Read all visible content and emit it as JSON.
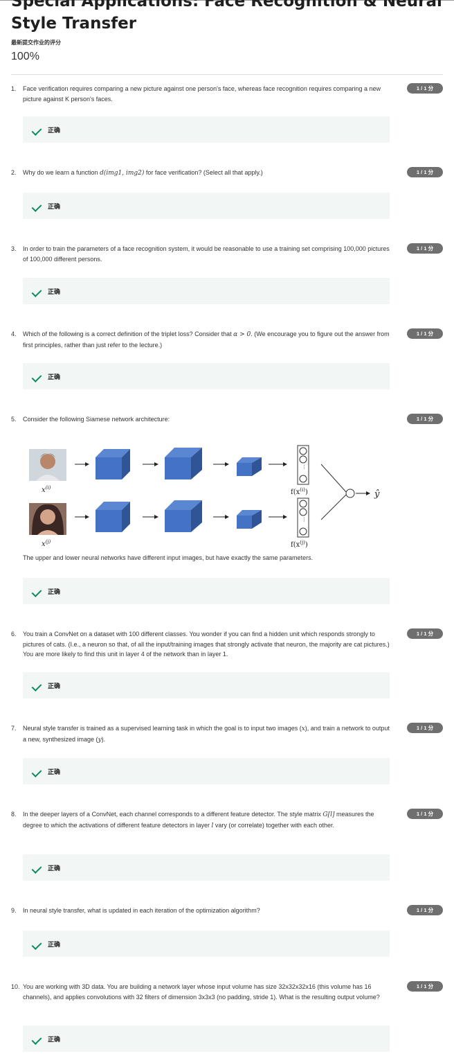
{
  "page": {
    "title": "Special Applications: Face Recognition & Neural Style Transfer",
    "grade_label": "最新提交作业的评分",
    "grade_value": "100%"
  },
  "correct_label": "正确",
  "questions": [
    {
      "num": "1.",
      "text": "Face verification requires comparing a new picture against one person's face, whereas face recognition requires comparing a new picture against K person's faces.",
      "score": "1 / 1 分"
    },
    {
      "num": "2.",
      "text_before": "Why do we learn a function ",
      "formula": "d(img1, img2)",
      "text_after": " for face verification? (Select all that apply.)",
      "score": "1 / 1 分"
    },
    {
      "num": "3.",
      "text": "In order to train the parameters of a face recognition system, it would be reasonable to use a training set comprising 100,000 pictures of 100,000 different persons.",
      "score": "1 / 1 分"
    },
    {
      "num": "4.",
      "text_before": "Which of the following is a correct definition of the triplet loss? Consider that ",
      "formula": "α > 0",
      "text_after": ". (We encourage you to figure out the answer from first principles, rather than just refer to the lecture.)",
      "score": "1 / 1 分"
    },
    {
      "num": "5.",
      "text": "Consider the following Siamese network architecture:",
      "score": "1 / 1 分",
      "caption": "The upper and lower neural networks have different input images, but have exactly the same parameters.",
      "diagram": {
        "upper_input": "x(i)",
        "lower_input": "x(j)",
        "upper_output": "f(x(i))",
        "lower_output": "f(x(j))",
        "output": "ŷ"
      }
    },
    {
      "num": "6.",
      "text": "You train a ConvNet on a dataset with 100 different classes. You wonder if you can find a hidden unit which responds strongly to pictures of cats. (I.e., a neuron so that, of all the input/training images that strongly activate that neuron, the majority are cat pictures.) You are more likely to find this unit in layer 4 of the network than in layer 1.",
      "score": "1 / 1 分"
    },
    {
      "num": "7.",
      "text_before": "Neural style transfer is trained as a supervised learning task in which the goal is to input two images (",
      "formula": "x",
      "text_mid": "), and train a network to output a new, synthesized image (",
      "formula2": "y",
      "text_after": ").",
      "score": "1 / 1 分"
    },
    {
      "num": "8.",
      "text_before": "In the deeper layers of a ConvNet, each channel corresponds to a different feature detector. The style matrix ",
      "formula": "G[l]",
      "text_mid": " measures the degree to which the activations of different feature detectors in layer ",
      "formula2": "l",
      "text_after": " vary (or correlate) together with each other.",
      "score": "1 / 1 分"
    },
    {
      "num": "9.",
      "text": "In neural style transfer, what is updated in each iteration of the optimization algorithm?",
      "score": "1 / 1 分"
    },
    {
      "num": "10.",
      "text": "You are working with 3D data. You are building a network layer whose input volume has size 32x32x32x16 (this volume has 16 channels), and applies convolutions with 32 filters of dimension 3x3x3 (no padding, stride 1). What is the resulting output volume?",
      "score": "1 / 1 分"
    }
  ],
  "colors": {
    "check": "#0c8a5e",
    "correct_bg": "#f2f7f5",
    "score_pill": "#6f6f6f",
    "cube": "#4472c4"
  }
}
